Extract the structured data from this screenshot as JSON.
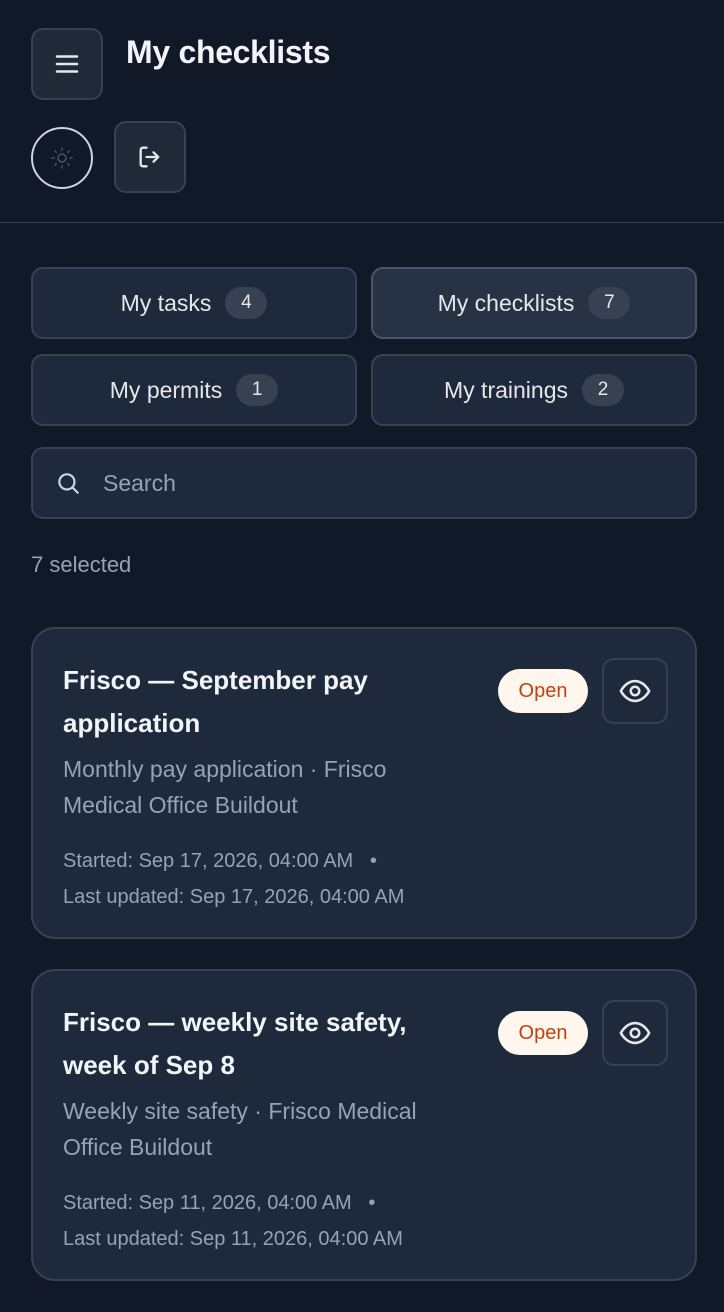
{
  "header": {
    "title": "My checklists",
    "menu_icon": "hamburger-menu-icon",
    "theme_icon": "sun-icon",
    "logout_icon": "logout-icon"
  },
  "tabs": [
    {
      "label": "My tasks",
      "count": "4"
    },
    {
      "label": "My checklists",
      "count": "7",
      "active": true
    },
    {
      "label": "My permits",
      "count": "1"
    },
    {
      "label": "My trainings",
      "count": "2"
    }
  ],
  "search": {
    "placeholder": "Search",
    "value": ""
  },
  "selection": {
    "text": "7 selected"
  },
  "cards": [
    {
      "title": "Frisco — September pay application",
      "subtitle": "Monthly pay application · Frisco Medical Office Buildout",
      "started": "Started: Sep 17, 2026, 04:00 AM",
      "separator": "•",
      "updated": "Last updated: Sep 17, 2026, 04:00 AM",
      "status": "Open"
    },
    {
      "title": "Frisco — weekly site safety, week of Sep 8",
      "subtitle": "Weekly site safety · Frisco Medical Office Buildout",
      "started": "Started: Sep 11, 2026, 04:00 AM",
      "separator": "•",
      "updated": "Last updated: Sep 11, 2026, 04:00 AM",
      "status": "Open"
    }
  ],
  "colors": {
    "background": "#111827",
    "surface": "#1e293b",
    "border": "#374151",
    "status_open_bg": "#fff7ed",
    "status_open_text": "#c2410c"
  }
}
